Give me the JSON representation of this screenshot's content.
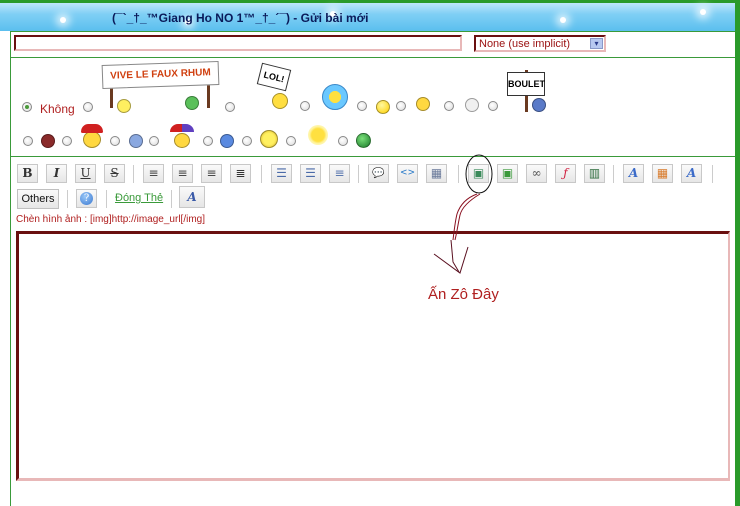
{
  "header": {
    "title": "(¯`_†_™Giang Ho NO 1™_†_´¯) - Gửi bài mới"
  },
  "subject": {
    "value": "",
    "placeholder": ""
  },
  "post_icon_select": {
    "selected": "None (use implicit)",
    "arrow": "▾"
  },
  "smilies": {
    "none_label": "Không",
    "row1": [
      {
        "name": "vive-le-faux-rhum",
        "sign": "VIVE LE FAUX RHUM"
      },
      {
        "name": "lol-sign",
        "sign": "LOL!"
      },
      {
        "name": "flower-smile"
      },
      {
        "name": "yellow-ball"
      },
      {
        "name": "thumbs-up"
      },
      {
        "name": "neutral-face"
      },
      {
        "name": "boulet-sign",
        "sign": "BOULET"
      }
    ],
    "row2": [
      {
        "name": "red-grin"
      },
      {
        "name": "santa"
      },
      {
        "name": "blue-grin"
      },
      {
        "name": "jester"
      },
      {
        "name": "cool-blue"
      },
      {
        "name": "yellow-grin"
      },
      {
        "name": "sun"
      },
      {
        "name": "green-face"
      }
    ]
  },
  "toolbar": {
    "row1": [
      {
        "name": "bold",
        "glyph": "B"
      },
      {
        "name": "italic",
        "glyph": "I"
      },
      {
        "name": "underline",
        "glyph": "U"
      },
      {
        "name": "strikethrough",
        "glyph": "S"
      },
      {
        "name": "align-left",
        "glyph": "≡"
      },
      {
        "name": "align-center",
        "glyph": "≡"
      },
      {
        "name": "align-right",
        "glyph": "≡"
      },
      {
        "name": "justify",
        "glyph": "≣"
      },
      {
        "name": "unordered-list",
        "glyph": "☰"
      },
      {
        "name": "ordered-list",
        "glyph": "☰"
      },
      {
        "name": "indent",
        "glyph": "≡"
      },
      {
        "name": "quote",
        "glyph": "💬"
      },
      {
        "name": "code",
        "glyph": "<>"
      },
      {
        "name": "table",
        "glyph": "▦"
      },
      {
        "name": "upload-image",
        "glyph": "▣"
      },
      {
        "name": "insert-image",
        "glyph": "▣"
      },
      {
        "name": "insert-link",
        "glyph": "∞"
      },
      {
        "name": "flash",
        "glyph": "ƒ"
      },
      {
        "name": "video",
        "glyph": "▥"
      },
      {
        "name": "font-face",
        "glyph": "A"
      },
      {
        "name": "color-palette",
        "glyph": "▦"
      },
      {
        "name": "font-size",
        "glyph": "A"
      }
    ],
    "others_label": "Others",
    "help_glyph": "?",
    "close_tags_label": "Đóng Thẻ",
    "font-switch_glyph": "A"
  },
  "hint": "Chèn hình ảnh : [img]http://image_url[/img]",
  "editor": {
    "value": ""
  },
  "annotation": {
    "text": "Ấn Zô Đây"
  }
}
